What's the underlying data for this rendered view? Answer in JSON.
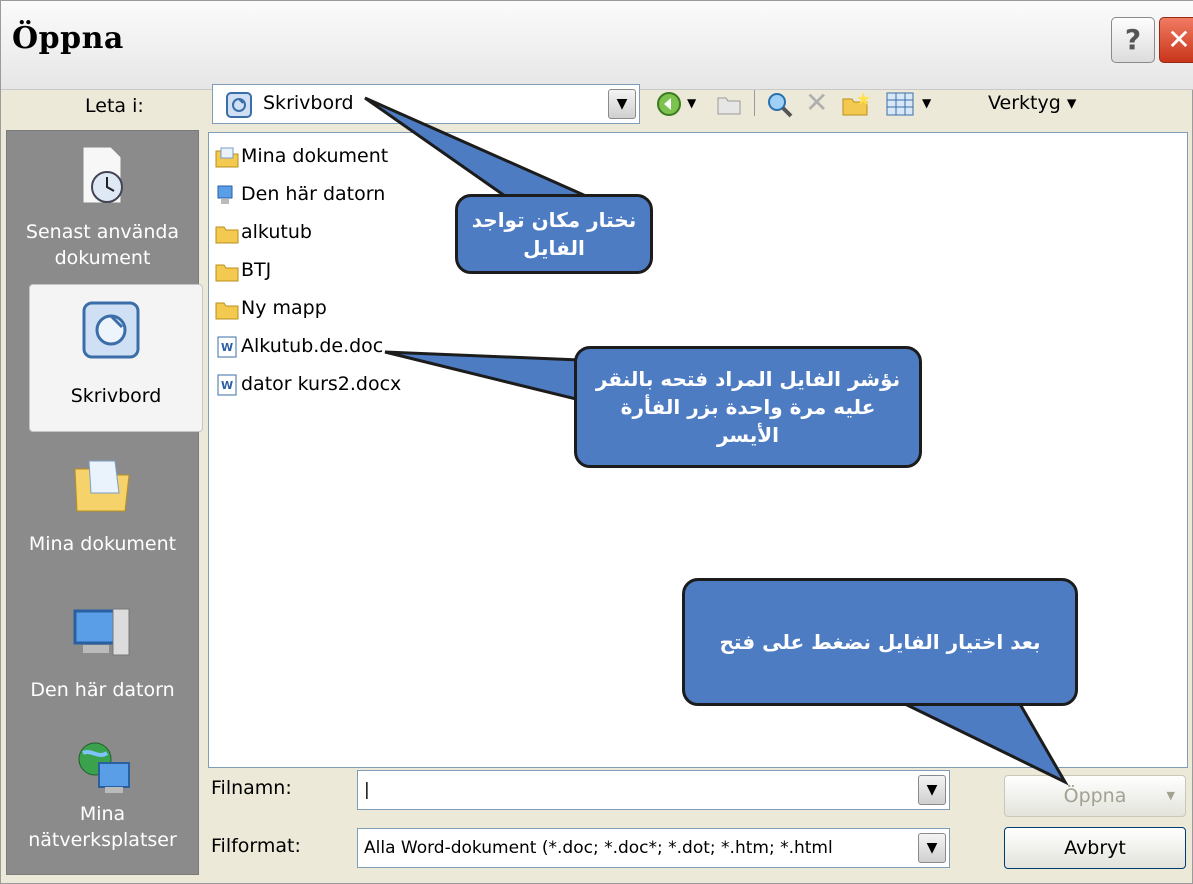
{
  "window": {
    "title": "Öppna",
    "help_label": "?",
    "close_label": "✕"
  },
  "lookin": {
    "label": "Leta i:",
    "value": "Skrivbord"
  },
  "toolbar": {
    "tools_label": "Verktyg ▾"
  },
  "places": [
    {
      "label": "Senast använda dokument"
    },
    {
      "label": "Skrivbord"
    },
    {
      "label": "Mina dokument"
    },
    {
      "label": "Den här datorn"
    },
    {
      "label": "Mina nätverksplatser"
    }
  ],
  "files": [
    {
      "name": "Mina dokument",
      "icon": "docs-folder-icon"
    },
    {
      "name": "Den här datorn",
      "icon": "computer-icon"
    },
    {
      "name": "alkutub",
      "icon": "folder-icon"
    },
    {
      "name": "BTJ",
      "icon": "folder-icon"
    },
    {
      "name": "Ny mapp",
      "icon": "folder-icon"
    },
    {
      "name": "Alkutub.de.doc",
      "icon": "word-doc-icon"
    },
    {
      "name": "dator kurs2.docx",
      "icon": "word-doc-icon"
    }
  ],
  "filename": {
    "label": "Filnamn:",
    "value": "|"
  },
  "filetype": {
    "label": "Filformat:",
    "value": "Alla Word-dokument (*.doc; *.doc*; *.dot; *.htm; *.html"
  },
  "buttons": {
    "open": "Öppna",
    "cancel": "Avbryt"
  },
  "callouts": {
    "location": "نختار مكان تواجد الفايل",
    "select_file": "نؤشر الفايل المراد فتحه بالنقر عليه مرة واحدة بزر الفأرة الأيسر",
    "open_hint": "بعد اختيار الفايل نضغط على فتح"
  },
  "colors": {
    "callout_fill": "#4d7cc3",
    "places_bg": "#8b8b8b"
  }
}
